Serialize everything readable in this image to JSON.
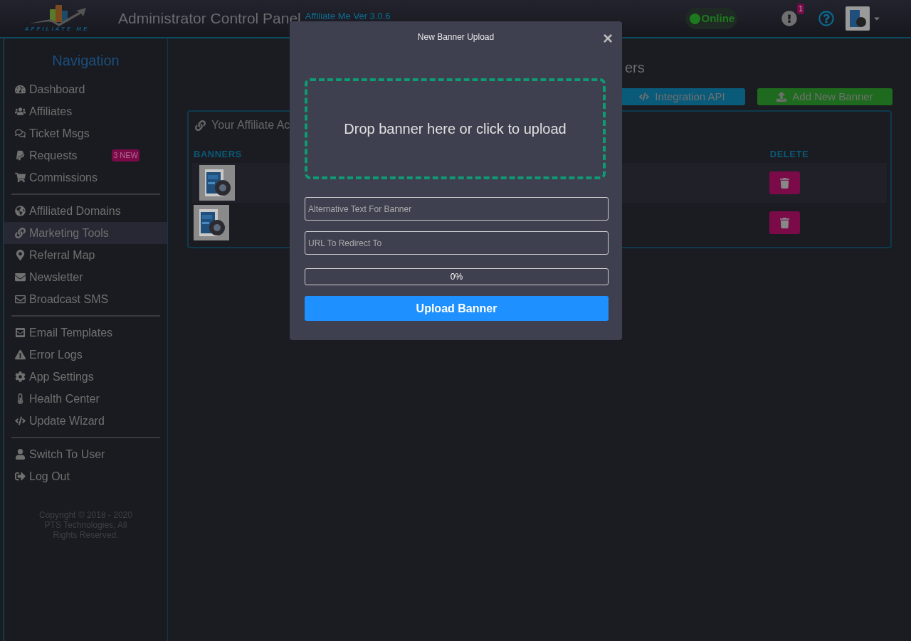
{
  "header": {
    "logo_text": "AFFILIATE ME",
    "title": "Administrator Control Panel",
    "version": "Affiliate Me Ver 3.0.6",
    "status": "Online",
    "online": true,
    "alert_count": "1"
  },
  "sidebar": {
    "title": "Navigation",
    "groups": [
      {
        "items": [
          {
            "label": "Dashboard",
            "selected": false
          },
          {
            "label": "Affiliates",
            "selected": false
          },
          {
            "label": "Ticket Msgs",
            "selected": false
          },
          {
            "label": "Requests",
            "selected": false,
            "badge": "3 NEW"
          },
          {
            "label": "Commissions",
            "selected": false
          }
        ]
      },
      {
        "items": [
          {
            "label": "Affiliated Domains",
            "selected": false
          },
          {
            "label": "Marketing Tools",
            "selected": true
          },
          {
            "label": "Referral Map",
            "selected": false
          },
          {
            "label": "Newsletter",
            "selected": false
          },
          {
            "label": "Broadcast SMS",
            "selected": false
          }
        ]
      },
      {
        "items": [
          {
            "label": "Email Templates",
            "selected": false
          },
          {
            "label": "Error Logs",
            "selected": false
          },
          {
            "label": "App Settings",
            "selected": false
          },
          {
            "label": "Health Center",
            "selected": false
          },
          {
            "label": "Update Wizard",
            "selected": false
          }
        ]
      },
      {
        "items": [
          {
            "label": "Switch To User",
            "selected": false
          },
          {
            "label": "Log Out",
            "selected": false
          }
        ]
      }
    ],
    "copyright": "Copyright © 2018 - 2020 PTS Technologies, All Rights Reserved."
  },
  "page": {
    "title": "ers",
    "buttons": [
      {
        "kind": "api",
        "label": "Integration API"
      },
      {
        "kind": "add",
        "label": "Add New Banner"
      }
    ],
    "panel": {
      "title": "Your Affiliate Ac",
      "columns": [
        "BANNERS",
        "DELETE"
      ]
    }
  },
  "modal": {
    "title": "New Banner Upload",
    "close": "×",
    "dropzone": "Drop banner here or click to upload",
    "fields": [
      {
        "placeholder": "Alternative Text For Banner"
      },
      {
        "placeholder": "URL To Redirect To"
      }
    ],
    "progress": {
      "level": 0,
      "reading": "0%"
    },
    "submit": "Upload Banner"
  }
}
